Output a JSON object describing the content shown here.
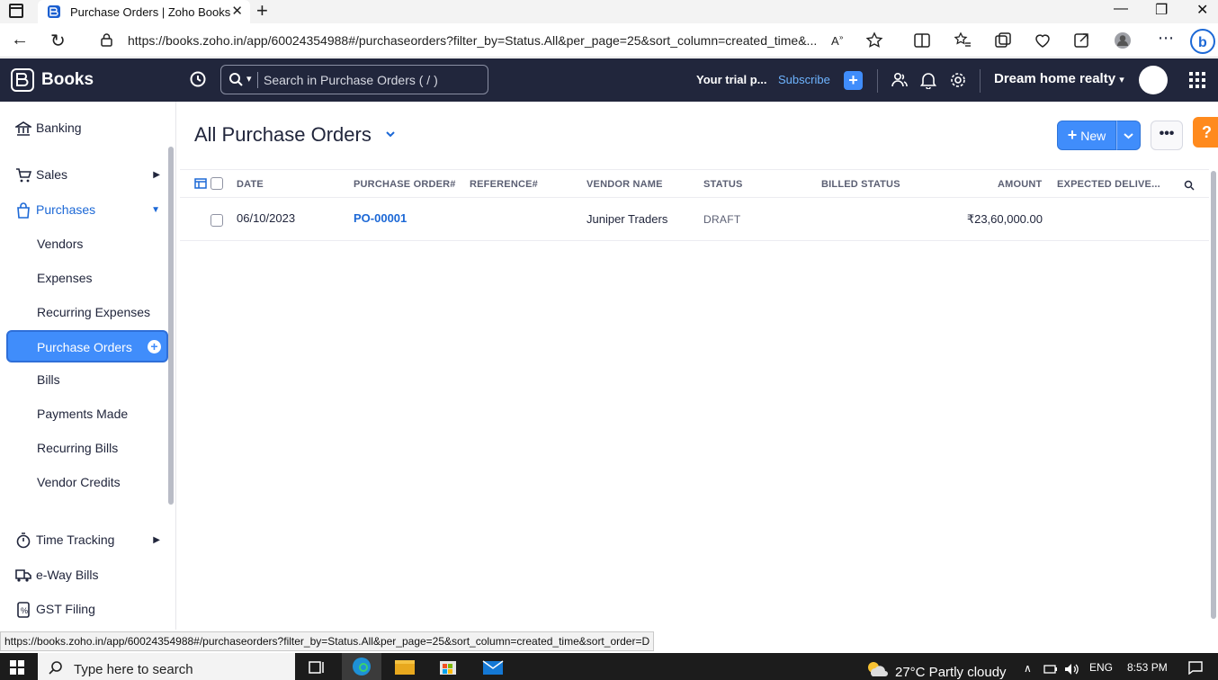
{
  "browser": {
    "tab_title": "Purchase Orders | Zoho Books",
    "url": "https://books.zoho.in/app/60024354988#/purchaseorders?filter_by=Status.All&per_page=25&sort_column=created_time&...",
    "status_url": "https://books.zoho.in/app/60024354988#/purchaseorders?filter_by=Status.All&per_page=25&sort_column=created_time&sort_order=D"
  },
  "header": {
    "brand": "Books",
    "search_placeholder": "Search in Purchase Orders ( / )",
    "trial_text": "Your trial p...",
    "subscribe": "Subscribe",
    "org_name": "Dream home realty"
  },
  "sidebar": {
    "banking": "Banking",
    "sales": "Sales",
    "purchases": "Purchases",
    "sub_items": [
      "Vendors",
      "Expenses",
      "Recurring Expenses",
      "Purchase Orders",
      "Bills",
      "Payments Made",
      "Recurring Bills",
      "Vendor Credits"
    ],
    "time_tracking": "Time Tracking",
    "eway_bills": "e-Way Bills",
    "gst_filing": "GST Filing"
  },
  "main": {
    "title": "All Purchase Orders",
    "new_button": "New",
    "columns": [
      "DATE",
      "PURCHASE ORDER#",
      "REFERENCE#",
      "VENDOR NAME",
      "STATUS",
      "BILLED STATUS",
      "AMOUNT",
      "EXPECTED DELIVE..."
    ],
    "rows": [
      {
        "date": "06/10/2023",
        "po_number": "PO-00001",
        "reference": "",
        "vendor": "Juniper Traders",
        "status": "DRAFT",
        "billed_status": "",
        "amount": "₹23,60,000.00",
        "expected_delivery": ""
      }
    ]
  },
  "taskbar": {
    "search_placeholder": "Type here to search",
    "weather": "27°C  Partly cloudy",
    "lang": "ENG",
    "time": "8:53 PM"
  },
  "colors": {
    "header_bg": "#21263c",
    "accent": "#408dfb",
    "help": "#ff8a1d",
    "link": "#1c68d6"
  }
}
